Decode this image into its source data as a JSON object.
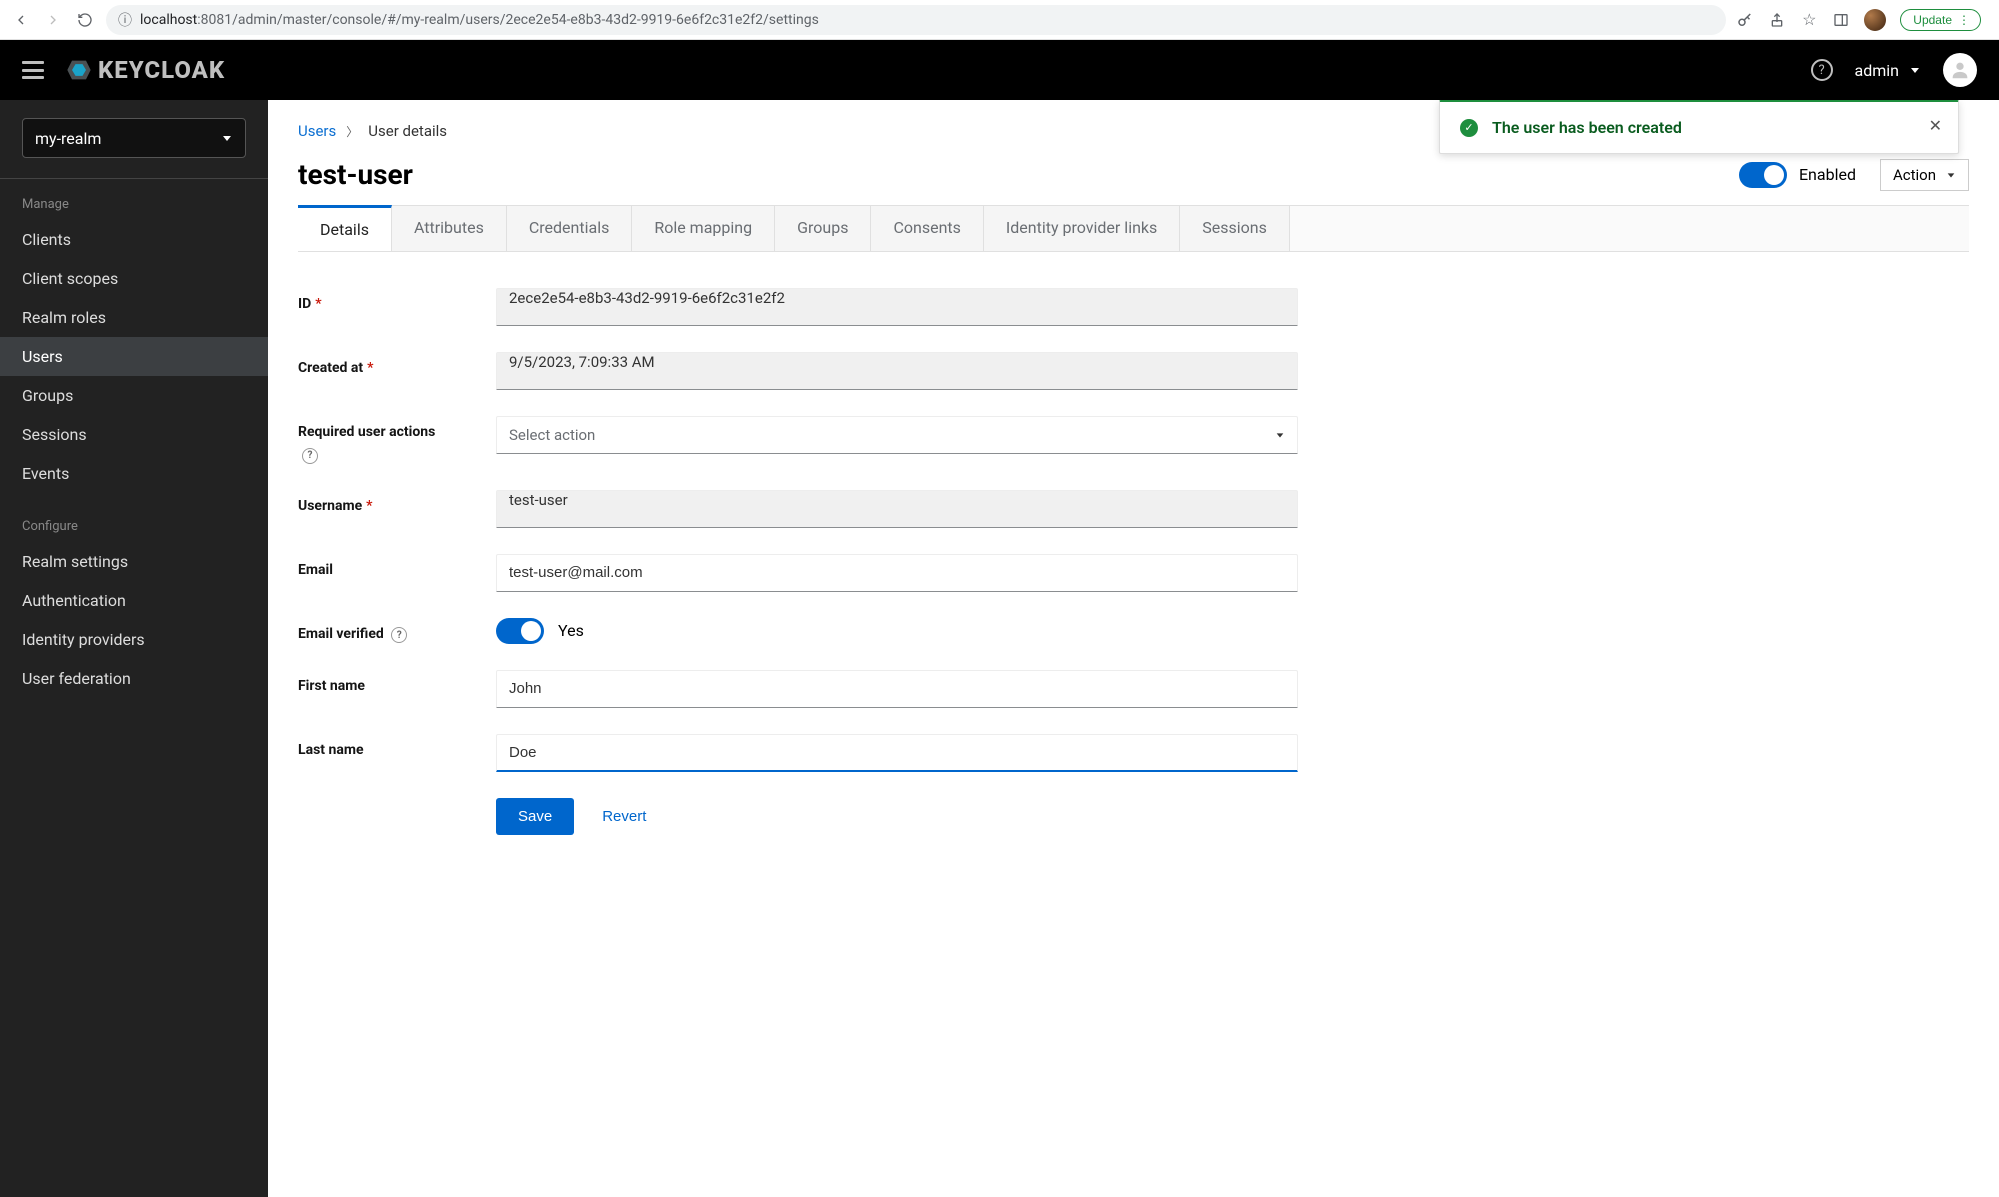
{
  "browser": {
    "url_host": "localhost",
    "url_port": ":8081",
    "url_path": "/admin/master/console/#/my-realm/users/2ece2e54-e8b3-43d2-9919-6e6f2c31e2f2/settings",
    "update_label": "Update"
  },
  "header": {
    "brand": "KEYCLOAK",
    "username": "admin"
  },
  "toast": {
    "message": "The user has been created"
  },
  "sidebar": {
    "realm": "my-realm",
    "sect_manage": "Manage",
    "sect_configure": "Configure",
    "manage_items": [
      {
        "label": "Clients"
      },
      {
        "label": "Client scopes"
      },
      {
        "label": "Realm roles"
      },
      {
        "label": "Users"
      },
      {
        "label": "Groups"
      },
      {
        "label": "Sessions"
      },
      {
        "label": "Events"
      }
    ],
    "configure_items": [
      {
        "label": "Realm settings"
      },
      {
        "label": "Authentication"
      },
      {
        "label": "Identity providers"
      },
      {
        "label": "User federation"
      }
    ]
  },
  "breadcrumb": {
    "root": "Users",
    "current": "User details"
  },
  "page": {
    "title": "test-user",
    "enabled_label": "Enabled",
    "action_label": "Action"
  },
  "tabs": [
    "Details",
    "Attributes",
    "Credentials",
    "Role mapping",
    "Groups",
    "Consents",
    "Identity provider links",
    "Sessions"
  ],
  "form": {
    "id_label": "ID",
    "id_value": "2ece2e54-e8b3-43d2-9919-6e6f2c31e2f2",
    "created_label": "Created at",
    "created_value": "9/5/2023, 7:09:33 AM",
    "reqactions_label": "Required user actions",
    "reqactions_placeholder": "Select action",
    "username_label": "Username",
    "username_value": "test-user",
    "email_label": "Email",
    "email_value": "test-user@mail.com",
    "emailverified_label": "Email verified",
    "emailverified_value": "Yes",
    "firstname_label": "First name",
    "firstname_value": "John",
    "lastname_label": "Last name",
    "lastname_value": "Doe",
    "save_label": "Save",
    "revert_label": "Revert"
  }
}
